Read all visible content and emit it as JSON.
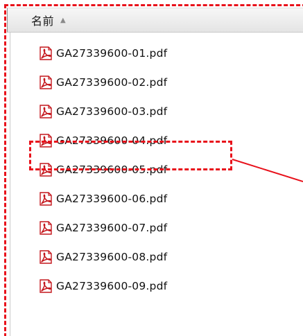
{
  "header": {
    "column_name": "名前",
    "sort_icon": "sort-ascending-icon"
  },
  "files": [
    {
      "name": "GA27339600-01.pdf",
      "icon": "pdf-file-icon"
    },
    {
      "name": "GA27339600-02.pdf",
      "icon": "pdf-file-icon"
    },
    {
      "name": "GA27339600-03.pdf",
      "icon": "pdf-file-icon"
    },
    {
      "name": "GA27339600-04.pdf",
      "icon": "pdf-file-icon",
      "highlighted": true
    },
    {
      "name": "GA27339600-05.pdf",
      "icon": "pdf-file-icon"
    },
    {
      "name": "GA27339600-06.pdf",
      "icon": "pdf-file-icon"
    },
    {
      "name": "GA27339600-07.pdf",
      "icon": "pdf-file-icon"
    },
    {
      "name": "GA27339600-08.pdf",
      "icon": "pdf-file-icon"
    },
    {
      "name": "GA27339600-09.pdf",
      "icon": "pdf-file-icon"
    }
  ],
  "colors": {
    "highlight": "#e8101a",
    "pdf_icon": "#c4161c"
  }
}
